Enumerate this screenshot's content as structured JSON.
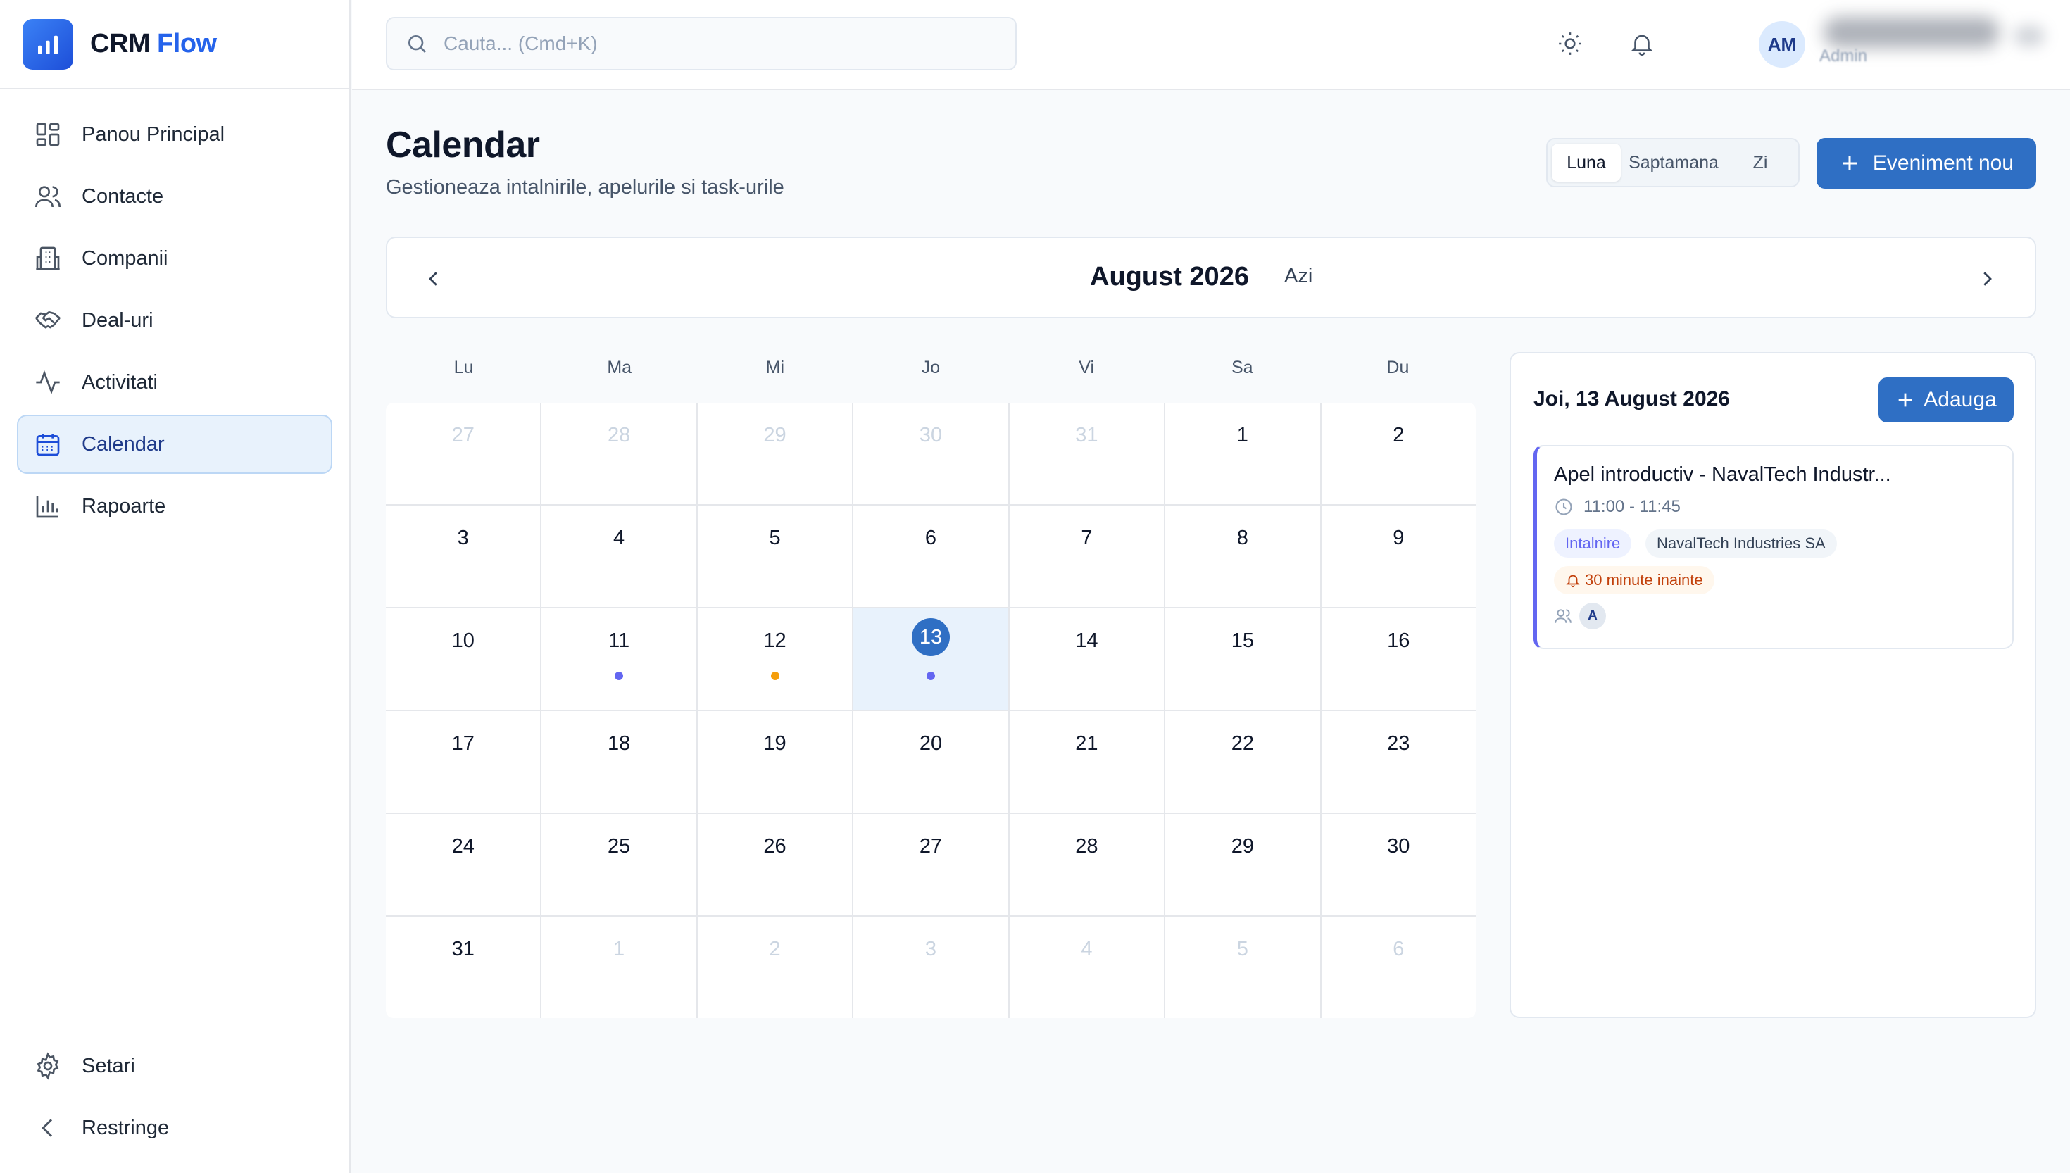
{
  "brand": {
    "name": "CRM",
    "accent": "Flow"
  },
  "sidebar": {
    "items": [
      {
        "label": "Panou Principal",
        "icon": "dashboard-icon"
      },
      {
        "label": "Contacte",
        "icon": "users-icon"
      },
      {
        "label": "Companii",
        "icon": "building-icon"
      },
      {
        "label": "Deal-uri",
        "icon": "handshake-icon"
      },
      {
        "label": "Activitati",
        "icon": "activity-icon"
      },
      {
        "label": "Calendar",
        "icon": "calendar-icon",
        "active": true
      },
      {
        "label": "Rapoarte",
        "icon": "bar-chart-icon"
      }
    ],
    "bottom": [
      {
        "label": "Setari",
        "icon": "gear-icon"
      },
      {
        "label": "Restringe",
        "icon": "chevron-left-icon"
      }
    ]
  },
  "topbar": {
    "search_placeholder": "Cauta... (Cmd+K)",
    "user": {
      "initials": "AM",
      "role": "Admin"
    }
  },
  "page": {
    "title": "Calendar",
    "subtitle": "Gestioneaza intalnirile, apelurile si task-urile"
  },
  "view_switch": {
    "options": [
      "Luna",
      "Saptamana",
      "Zi"
    ],
    "selected": "Luna"
  },
  "actions": {
    "new_event": "Eveniment nou",
    "add": "Adauga"
  },
  "calendar": {
    "month_label": "August 2026",
    "today_label": "Azi",
    "weekdays": [
      "Lu",
      "Ma",
      "Mi",
      "Jo",
      "Vi",
      "Sa",
      "Du"
    ],
    "days": [
      {
        "n": "27",
        "out": true
      },
      {
        "n": "28",
        "out": true
      },
      {
        "n": "29",
        "out": true
      },
      {
        "n": "30",
        "out": true
      },
      {
        "n": "31",
        "out": true
      },
      {
        "n": "1"
      },
      {
        "n": "2"
      },
      {
        "n": "3"
      },
      {
        "n": "4"
      },
      {
        "n": "5"
      },
      {
        "n": "6"
      },
      {
        "n": "7"
      },
      {
        "n": "8"
      },
      {
        "n": "9"
      },
      {
        "n": "10"
      },
      {
        "n": "11",
        "dot": "#6366f1"
      },
      {
        "n": "12",
        "dot": "#f59e0b"
      },
      {
        "n": "13",
        "selected": true,
        "dot": "#6366f1"
      },
      {
        "n": "14"
      },
      {
        "n": "15"
      },
      {
        "n": "16"
      },
      {
        "n": "17"
      },
      {
        "n": "18"
      },
      {
        "n": "19"
      },
      {
        "n": "20"
      },
      {
        "n": "21"
      },
      {
        "n": "22"
      },
      {
        "n": "23"
      },
      {
        "n": "24"
      },
      {
        "n": "25"
      },
      {
        "n": "26"
      },
      {
        "n": "27"
      },
      {
        "n": "28"
      },
      {
        "n": "29"
      },
      {
        "n": "30"
      },
      {
        "n": "31"
      },
      {
        "n": "1",
        "out": true
      },
      {
        "n": "2",
        "out": true
      },
      {
        "n": "3",
        "out": true
      },
      {
        "n": "4",
        "out": true
      },
      {
        "n": "5",
        "out": true
      },
      {
        "n": "6",
        "out": true
      }
    ]
  },
  "day_panel": {
    "title": "Joi, 13 August 2026",
    "events": [
      {
        "title": "Apel introductiv - NavalTech Industr...",
        "time": "11:00 - 11:45",
        "type": "Intalnire",
        "company": "NavalTech Industries SA",
        "reminder": "30 minute inainte",
        "participant": "A"
      }
    ]
  },
  "colors": {
    "primary": "#2f6fc4",
    "accent_blue": "#2563eb",
    "active_nav_bg": "#e8f2fc",
    "meeting": "#6366f1",
    "call": "#f59e0b"
  }
}
